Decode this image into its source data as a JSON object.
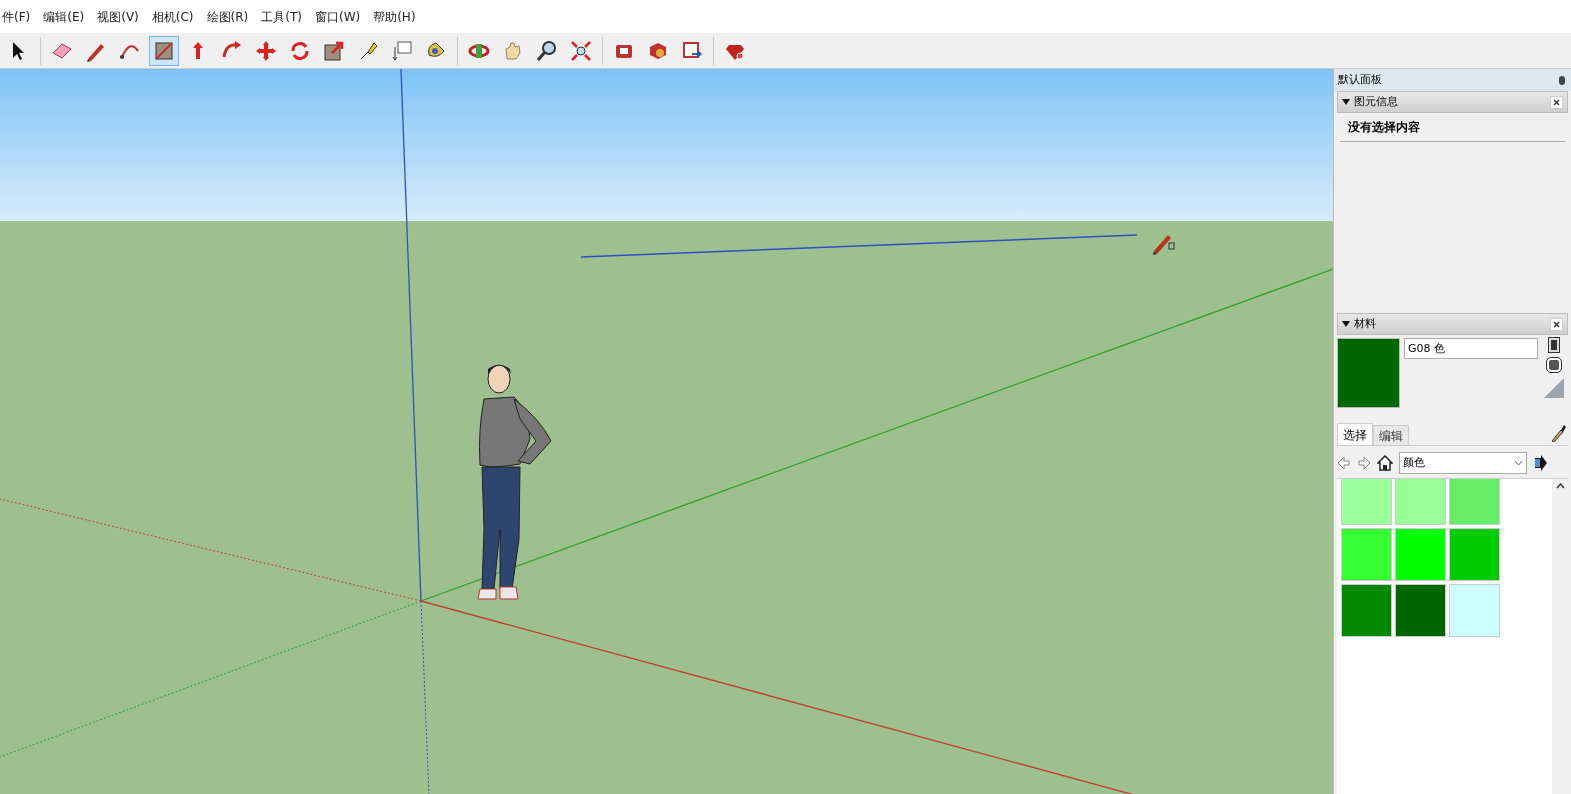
{
  "menu": [
    "件(F)",
    "编辑(E)",
    "视图(V)",
    "相机(C)",
    "绘图(R)",
    "工具(T)",
    "窗口(W)",
    "帮助(H)"
  ],
  "toolbar": [
    {
      "kind": "select",
      "selected": false
    },
    {
      "kind": "eraser",
      "selected": false
    },
    {
      "kind": "pencil",
      "selected": false
    },
    {
      "kind": "arc",
      "selected": false
    },
    {
      "kind": "rectangle",
      "selected": true
    },
    {
      "kind": "pushpull",
      "selected": false
    },
    {
      "kind": "followme",
      "selected": false
    },
    {
      "kind": "move",
      "selected": false
    },
    {
      "kind": "rotate",
      "selected": false
    },
    {
      "kind": "scale",
      "selected": false
    },
    {
      "kind": "tape",
      "selected": false
    },
    {
      "kind": "text",
      "selected": false
    },
    {
      "kind": "paint",
      "selected": false
    },
    {
      "kind": "orbit",
      "selected": false
    },
    {
      "kind": "pan",
      "selected": false
    },
    {
      "kind": "zoom",
      "selected": false
    },
    {
      "kind": "zoomext",
      "selected": false
    },
    {
      "kind": "warehouse",
      "selected": false
    },
    {
      "kind": "extension",
      "selected": false
    },
    {
      "kind": "share",
      "selected": false
    },
    {
      "kind": "ruby",
      "selected": false
    }
  ],
  "tray": {
    "title": "默认面板",
    "entity_info": {
      "title": "图元信息",
      "expanded": true,
      "message": "没有选择内容"
    },
    "materials": {
      "title": "材料",
      "expanded": true,
      "name": "G08 色",
      "tabs": [
        {
          "label": "选择",
          "selected": true
        },
        {
          "label": "编辑",
          "selected": false
        }
      ],
      "library": "颜色",
      "swatches": [
        {
          "color": "#99ff99"
        },
        {
          "color": "#99ff99"
        },
        {
          "color": "#66ee66"
        },
        {
          "color": "#33ff33"
        },
        {
          "color": "#00ff00"
        },
        {
          "color": "#00cc00"
        },
        {
          "color": "#008800"
        },
        {
          "color": "#006600"
        },
        {
          "color": "#ccffff"
        }
      ]
    }
  }
}
